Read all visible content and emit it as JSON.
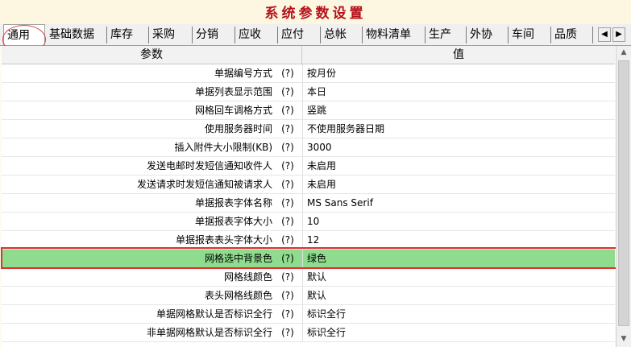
{
  "window": {
    "title": "系统参数设置"
  },
  "tabs": [
    {
      "label": "通用",
      "active": true
    },
    {
      "label": "基础数据"
    },
    {
      "label": "库存"
    },
    {
      "label": "采购"
    },
    {
      "label": "分销"
    },
    {
      "label": "应收"
    },
    {
      "label": "应付"
    },
    {
      "label": "总帐"
    },
    {
      "label": "物料清单"
    },
    {
      "label": "生产"
    },
    {
      "label": "外协"
    },
    {
      "label": "车间"
    },
    {
      "label": "品质"
    }
  ],
  "tab_scroll": {
    "left_icon": "◀",
    "right_icon": "▶"
  },
  "grid": {
    "columns": {
      "param": "参数",
      "value": "值"
    },
    "help_label": "(?)",
    "rows": [
      {
        "name": "单据编号方式",
        "value": "按月份"
      },
      {
        "name": "单据列表显示范围",
        "value": "本日"
      },
      {
        "name": "网格回车调格方式",
        "value": "竖跳"
      },
      {
        "name": "使用服务器时间",
        "value": "不使用服务器日期"
      },
      {
        "name": "插入附件大小限制(KB)",
        "value": "3000"
      },
      {
        "name": "发送电邮时发短信通知收件人",
        "value": "未启用"
      },
      {
        "name": "发送请求时发短信通知被请求人",
        "value": "未启用"
      },
      {
        "name": "单据报表字体名称",
        "value": "MS Sans Serif"
      },
      {
        "name": "单据报表字体大小",
        "value": "10"
      },
      {
        "name": "单据报表表头字体大小",
        "value": "12"
      },
      {
        "name": "网格选中背景色",
        "value": "绿色",
        "selected": true
      },
      {
        "name": "网格线颜色",
        "value": "默认"
      },
      {
        "name": "表头网格线颜色",
        "value": "默认"
      },
      {
        "name": "单据网格默认是否标识全行",
        "value": "标识全行"
      },
      {
        "name": "非单据网格默认是否标识全行",
        "value": "标识全行"
      }
    ]
  },
  "scrollbar": {
    "up_icon": "▲",
    "down_icon": "▼"
  },
  "colors": {
    "title": "#b5121b",
    "selected_row": "#8fdc8f",
    "highlight": "#e03030"
  }
}
